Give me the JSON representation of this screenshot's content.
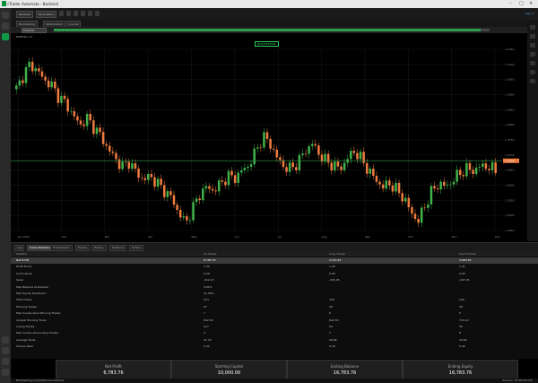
{
  "app": {
    "title": "cTrader Automate - Backtest"
  },
  "toolbar": {
    "buttons": [
      "Backtest",
      "Parameters"
    ],
    "link": "Sign in"
  },
  "tabs": [
    "Backtesting",
    "Optimization",
    "Journal"
  ],
  "progress": {
    "symbol": "EURUSD",
    "value": 0.97
  },
  "chart": {
    "label": "EURUSD, h1",
    "center_label": "BACKTESTING",
    "price_ticks": [
      "1.1050",
      "1.1000",
      "1.0950",
      "1.0900",
      "1.0850",
      "1.0800",
      "1.0750",
      "1.0700",
      "1.0650",
      "1.0600",
      "1.0550",
      "1.0500",
      "1.0450"
    ],
    "current_price": "1.0790",
    "date_ticks": [
      "Jan 2023",
      "Feb",
      "Mar",
      "Apr",
      "May",
      "Jun",
      "Jul",
      "Aug",
      "Sep",
      "Oct",
      "Nov",
      "Dec"
    ]
  },
  "subtabs": [
    "Log",
    "Trade Statistics",
    "Transactions",
    "Events",
    "History",
    "Positions",
    "Orders"
  ],
  "table": {
    "headers": [
      "Statistic",
      "All Trades",
      "Long Trades",
      "Short Trades"
    ],
    "rows": [
      [
        "Net Profit",
        "6,783.76",
        "3,120.40",
        "3,663.36"
      ],
      [
        "Profit Factor",
        "1.34",
        "1.28",
        "1.41"
      ],
      [
        "Commission",
        "0.00",
        "0.00",
        "0.00"
      ],
      [
        "Swap",
        "-412.10",
        "-205.05",
        "-207.05"
      ],
      [
        "Max Balance Drawdown",
        "9.82%",
        "",
        ""
      ],
      [
        "Max Equity Drawdown",
        "11.36%",
        "",
        ""
      ],
      [
        "Total Trades",
        "214",
        "108",
        "106"
      ],
      [
        "Winning Trades",
        "97",
        "49",
        "48"
      ],
      [
        "Max Consecutive Winning Trades",
        "7",
        "6",
        "5"
      ],
      [
        "Largest Winning Trade",
        "842.30",
        "842.30",
        "716.10"
      ],
      [
        "Losing Trades",
        "117",
        "59",
        "58"
      ],
      [
        "Max Consecutive Losing Trades",
        "9",
        "7",
        "8"
      ],
      [
        "Average Trade",
        "31.70",
        "28.89",
        "34.56"
      ],
      [
        "Sharpe Ratio",
        "0.42",
        "0.39",
        "0.46"
      ]
    ]
  },
  "summary": [
    {
      "label": "Net Profit",
      "value": "6,783.76"
    },
    {
      "label": "Starting Capital",
      "value": "10,000.00"
    },
    {
      "label": "Ending Balance",
      "value": "16,783.76"
    },
    {
      "label": "Ending Equity",
      "value": "16,783.76"
    }
  ],
  "status": {
    "left": "Backtesting completed successfully",
    "right": "Servers: 12:00:00 UTC"
  },
  "colors": {
    "accent": "#2f9e4b",
    "up": "#3fb24a",
    "down": "#f07b3f"
  }
}
